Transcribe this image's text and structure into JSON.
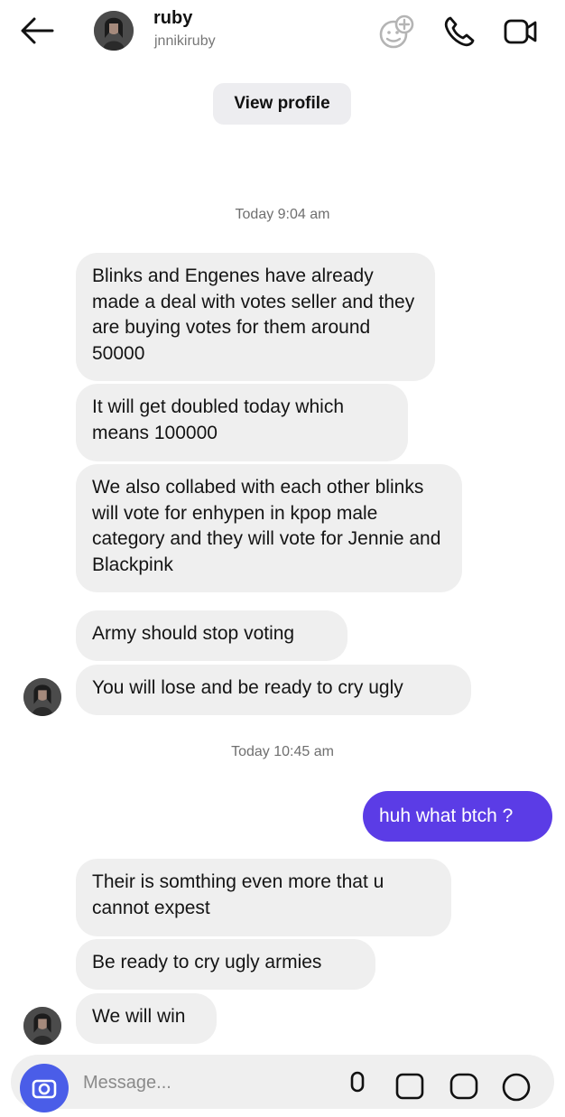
{
  "header": {
    "name": "ruby",
    "username": "jnnikiruby",
    "view_profile_label": "View profile"
  },
  "icons": {
    "back": "arrow-left-icon",
    "effects": "sticker-face-icon",
    "call": "phone-icon",
    "video": "video-camera-icon"
  },
  "colors": {
    "sent_bubble": "#5b3ce6",
    "received_bubble": "#efefef",
    "camera_button": "#4a5de8"
  },
  "conversation": {
    "timestamp_1": "Today 9:04 am",
    "timestamp_2": "Today 10:45 am",
    "messages": [
      {
        "from": "them",
        "text": "Blinks and Engenes have already made a deal with votes seller and they are buying votes for them around 50000"
      },
      {
        "from": "them",
        "text": "It will get doubled today which means 100000"
      },
      {
        "from": "them",
        "text": "We also collabed with each other blinks will vote for enhypen in kpop male category and they will vote for Jennie and Blackpink"
      },
      {
        "from": "them",
        "text": "Army should stop voting"
      },
      {
        "from": "them",
        "text": "You will lose and be ready to cry ugly"
      },
      {
        "from": "me",
        "text": "huh what btch ?"
      },
      {
        "from": "them",
        "text": "Their is somthing even more that u cannot expest"
      },
      {
        "from": "them",
        "text": "Be ready to cry ugly armies"
      },
      {
        "from": "them",
        "text": "We will win"
      }
    ]
  },
  "composer": {
    "placeholder": "Message..."
  }
}
